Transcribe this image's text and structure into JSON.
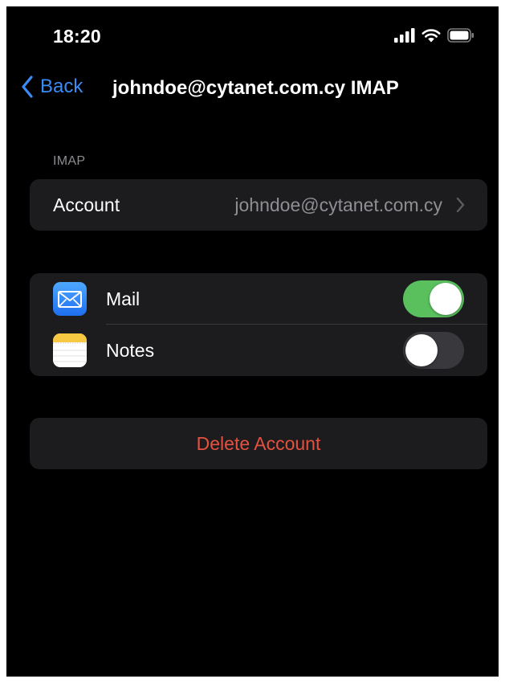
{
  "status_bar": {
    "time": "18:20",
    "icons": [
      "cellular-signal-icon",
      "wifi-icon",
      "battery-icon"
    ]
  },
  "nav": {
    "back_label": "Back",
    "title": "johndoe@cytanet.com.cy IMAP",
    "accent_color": "#3a8cf5"
  },
  "imap_section": {
    "header": "IMAP",
    "account_label": "Account",
    "account_value": "johndoe@cytanet.com.cy"
  },
  "apps": [
    {
      "label": "Mail",
      "icon": "mail-app-icon",
      "enabled": true
    },
    {
      "label": "Notes",
      "icon": "notes-app-icon",
      "enabled": false
    }
  ],
  "actions": {
    "delete_label": "Delete Account",
    "delete_color": "#e5513f"
  },
  "colors": {
    "background": "#000000",
    "cell": "#1c1c1e",
    "toggle_on": "#5ac05e",
    "toggle_off": "#39393d"
  }
}
